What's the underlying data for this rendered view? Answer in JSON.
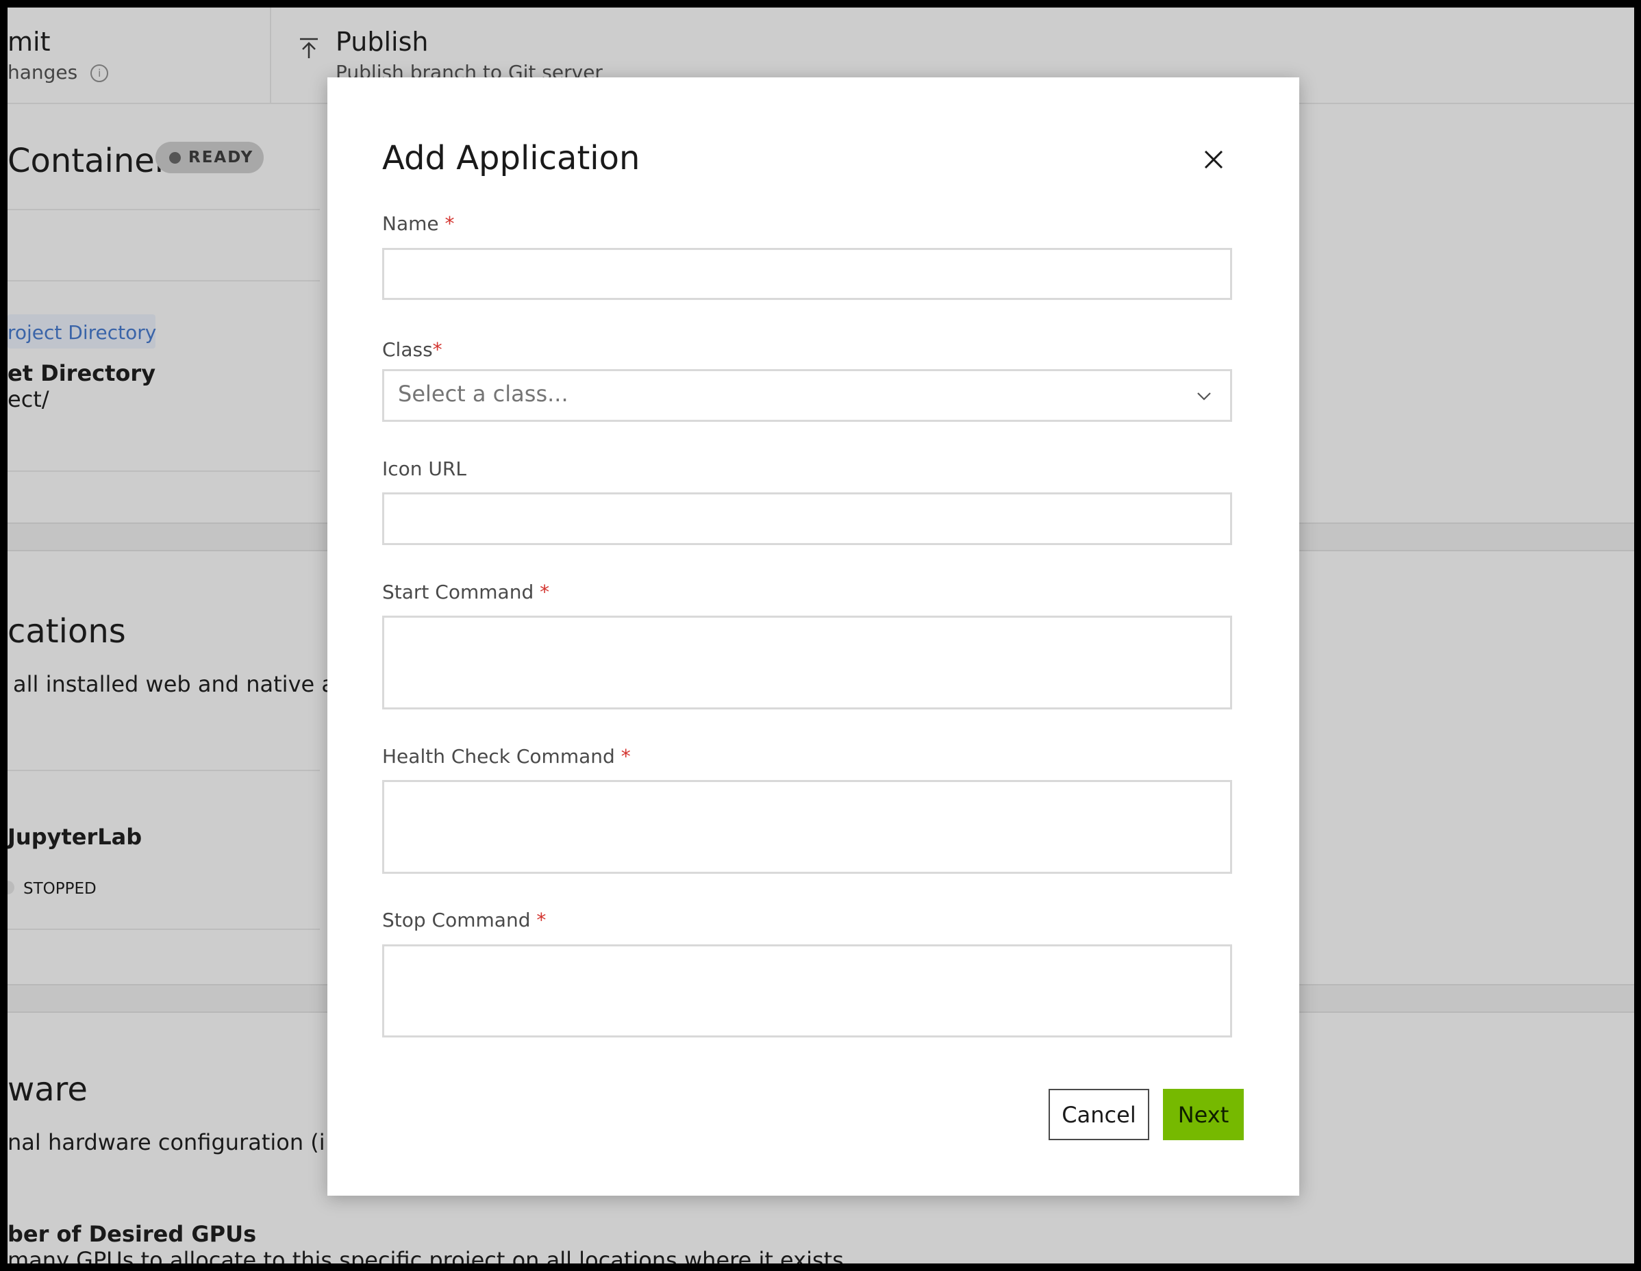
{
  "background": {
    "commit": {
      "title": "mit",
      "subtitle": "hanges",
      "info_icon": "info-icon"
    },
    "publish": {
      "title": "Publish",
      "subtitle": "Publish branch to Git server",
      "icon": "upload-icon"
    },
    "container": {
      "title": "Container",
      "status": "READY"
    },
    "project_dir_tag": "roject Directory",
    "target_dir": {
      "label": "et Directory",
      "value": "ect/"
    },
    "applications": {
      "title": "cations",
      "description": "all installed web and native ap"
    },
    "app_item": {
      "name": "JupyterLab",
      "status": "STOPPED"
    },
    "hardware": {
      "title": "ware",
      "description": "nal hardware configuration (i.e"
    },
    "gpus": {
      "label": "ber of Desired GPUs",
      "description": "many GPUs to allocate to this specific project on all locations where it exists."
    }
  },
  "modal": {
    "title": "Add Application",
    "fields": {
      "name": {
        "label": "Name",
        "required": "*",
        "value": ""
      },
      "class": {
        "label": "Class",
        "required": "*",
        "placeholder": "Select a class..."
      },
      "icon_url": {
        "label": "Icon URL",
        "value": ""
      },
      "start_command": {
        "label": "Start Command",
        "required": "*",
        "value": ""
      },
      "health_check_command": {
        "label": "Health Check Command",
        "required": "*",
        "value": ""
      },
      "stop_command": {
        "label": "Stop Command",
        "required": "*",
        "value": ""
      }
    },
    "buttons": {
      "cancel": "Cancel",
      "next": "Next"
    }
  },
  "colors": {
    "accent": "#76b900",
    "required": "#d3342f",
    "tag_text": "#3a64a8",
    "overlay_bg": "#cdcdcd"
  }
}
